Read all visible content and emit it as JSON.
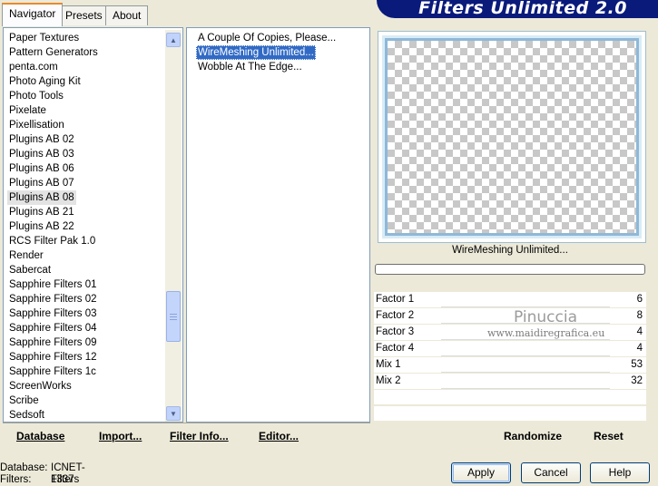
{
  "app": {
    "title": "Filters Unlimited 2.0"
  },
  "tabs": [
    {
      "label": "Navigator",
      "active": true
    },
    {
      "label": "Presets",
      "active": false
    },
    {
      "label": "About",
      "active": false
    }
  ],
  "categories": {
    "selected": "Plugins AB 08",
    "items": [
      "Paper Textures",
      "Pattern Generators",
      "penta.com",
      "Photo Aging Kit",
      "Photo Tools",
      "Pixelate",
      "Pixellisation",
      "Plugins AB 02",
      "Plugins AB 03",
      "Plugins AB 06",
      "Plugins AB 07",
      "Plugins AB 08",
      "Plugins AB 21",
      "Plugins AB 22",
      "RCS Filter Pak 1.0",
      "Render",
      "Sabercat",
      "Sapphire Filters 01",
      "Sapphire Filters 02",
      "Sapphire Filters 03",
      "Sapphire Filters 04",
      "Sapphire Filters 09",
      "Sapphire Filters 12",
      "Sapphire Filters 1c",
      "ScreenWorks",
      "Scribe",
      "Sedsoft"
    ]
  },
  "filters": {
    "selected": "WireMeshing Unlimited...",
    "items": [
      "A Couple Of Copies, Please...",
      "WireMeshing Unlimited...",
      "Wobble At The Edge..."
    ]
  },
  "preview": {
    "filter_name": "WireMeshing Unlimited..."
  },
  "params": [
    {
      "label": "Factor 1",
      "value": "6"
    },
    {
      "label": "Factor 2",
      "value": "8"
    },
    {
      "label": "Factor 3",
      "value": "4"
    },
    {
      "label": "Factor 4",
      "value": "4"
    },
    {
      "label": "Mix 1",
      "value": "53"
    },
    {
      "label": "Mix 2",
      "value": "32"
    }
  ],
  "watermark": {
    "name": "Pinuccia",
    "url": "www.maidiregrafica.eu"
  },
  "left_buttons": {
    "database": "Database",
    "import": "Import...",
    "filter_info": "Filter Info...",
    "editor": "Editor..."
  },
  "right_buttons": {
    "randomize": "Randomize",
    "reset": "Reset"
  },
  "dialog_buttons": {
    "apply": "Apply",
    "cancel": "Cancel",
    "help": "Help"
  },
  "status": {
    "database_label": "Database:",
    "database_value": "ICNET-Filters",
    "filters_label": "Filters:",
    "filters_value": "1337"
  },
  "colors": {
    "banner": "#0a1a7a",
    "selection": "#316ac5",
    "window_bg": "#ece9d8"
  }
}
